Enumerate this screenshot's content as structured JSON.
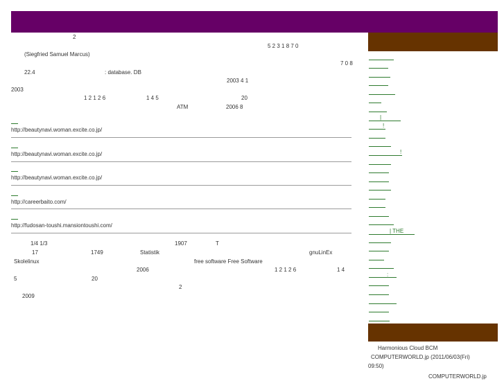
{
  "main": {
    "line1": {
      "a": "2",
      "b": "5   2   3      1 8 7 0"
    },
    "line2": {
      "a": "(Siegfried Samuel Marcus)"
    },
    "line3": {
      "a": "7 0 8"
    },
    "line4": {
      "a": "22.4",
      "b": ": database. DB"
    },
    "line5": {
      "a": "2003 4 1"
    },
    "line6": {
      "a": "2003"
    },
    "line7": {
      "a": "1 2      1 2  6",
      "b": "1   4     5",
      "c": "20"
    },
    "line8": {
      "a": "ATM",
      "b": "2006 8"
    }
  },
  "ads": [
    {
      "url": "http://beautynavi.woman.excite.co.jp/"
    },
    {
      "url": "http://beautynavi.woman.excite.co.jp/"
    },
    {
      "url": "http://beautynavi.woman.excite.co.jp/"
    },
    {
      "url": "http://careerbaito.com/"
    },
    {
      "url": "http://fudosan-toushi.mansiontoushi.com/"
    }
  ],
  "lower": {
    "r1": {
      "a": "1/4   1/3",
      "b": "1907",
      "c": "T"
    },
    "r2": {
      "a": "17",
      "b": "1749",
      "c": "Statistik",
      "d": "gnuLinEx"
    },
    "r3": {
      "a": "Skolelinux",
      "b": "free software  Free Software"
    },
    "r4": {
      "a": "2006",
      "b": "1 2      1 2  6",
      "c": "1   4"
    },
    "r5": {
      "a": "5",
      "b": "20"
    },
    "r6": {
      "a": "2"
    },
    "r7": {
      "a": "2009"
    }
  },
  "sidebar": {
    "marks": {
      "m1": "|",
      "m2": "!",
      "m3": "!",
      "m4": "| THE",
      "m5": ":"
    },
    "news": {
      "line1": "Harmonious Cloud  BCM",
      "line2": "COMPUTERWORLD.jp  (2011/06/03(Fri)",
      "line3": "09:50)",
      "line4": "COMPUTERWORLD.jp"
    }
  },
  "colors": {
    "header": "#660066",
    "sidebar_header": "#663300",
    "link": "#2d7a2d"
  }
}
